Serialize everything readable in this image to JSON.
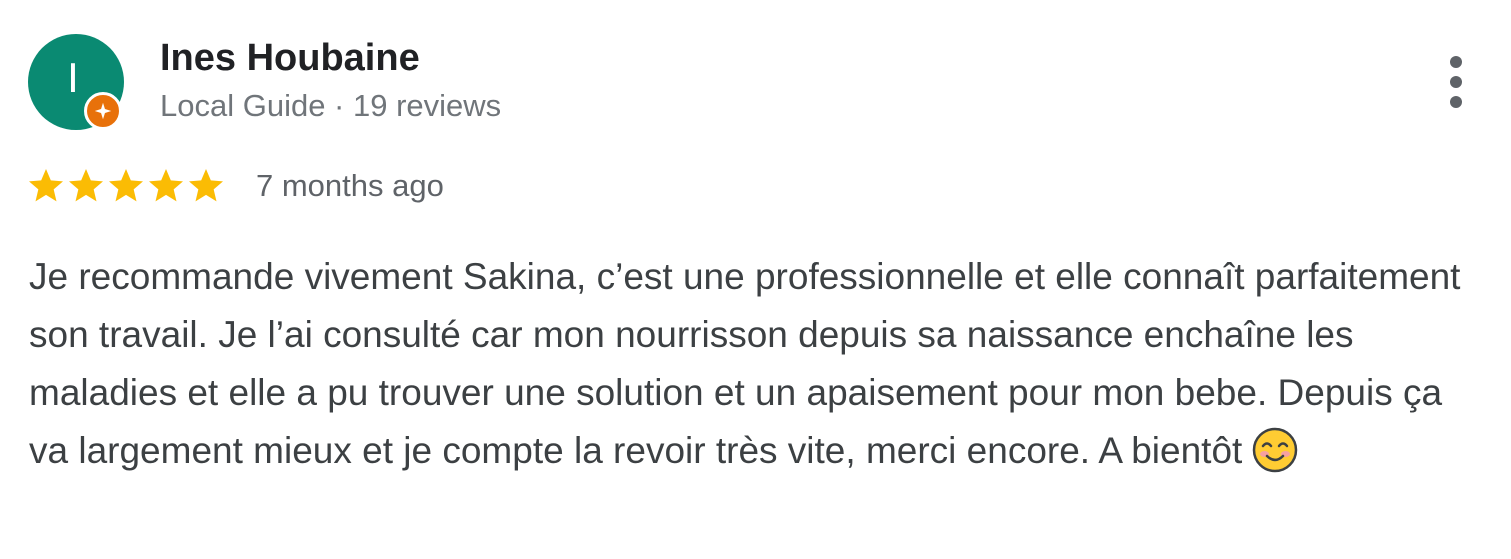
{
  "reviewer": {
    "initial": "I",
    "name": "Ines Houbaine",
    "meta": "Local Guide · 19 reviews",
    "avatar_color": "#0a8a72",
    "badge_color": "#e8710a",
    "badge_icon": "local-guide-star-icon"
  },
  "review": {
    "rating": 5,
    "rating_max": 5,
    "star_color": "#fbbc04",
    "time": "7 months ago",
    "text": "Je recommande vivement Sakina, c’est une professionnelle et elle connaît parfaitement son travail. Je l’ai consulté car mon nourrisson depuis sa naissance enchaîne les maladies et elle a pu trouver une solution et un apaisement pour mon bebe. Depuis ça va largement mieux et je compte la revoir très vite, merci encore. A bientôt",
    "emoji": "smiling-face-emoji"
  },
  "actions": {
    "more_icon": "more-vert-icon"
  }
}
